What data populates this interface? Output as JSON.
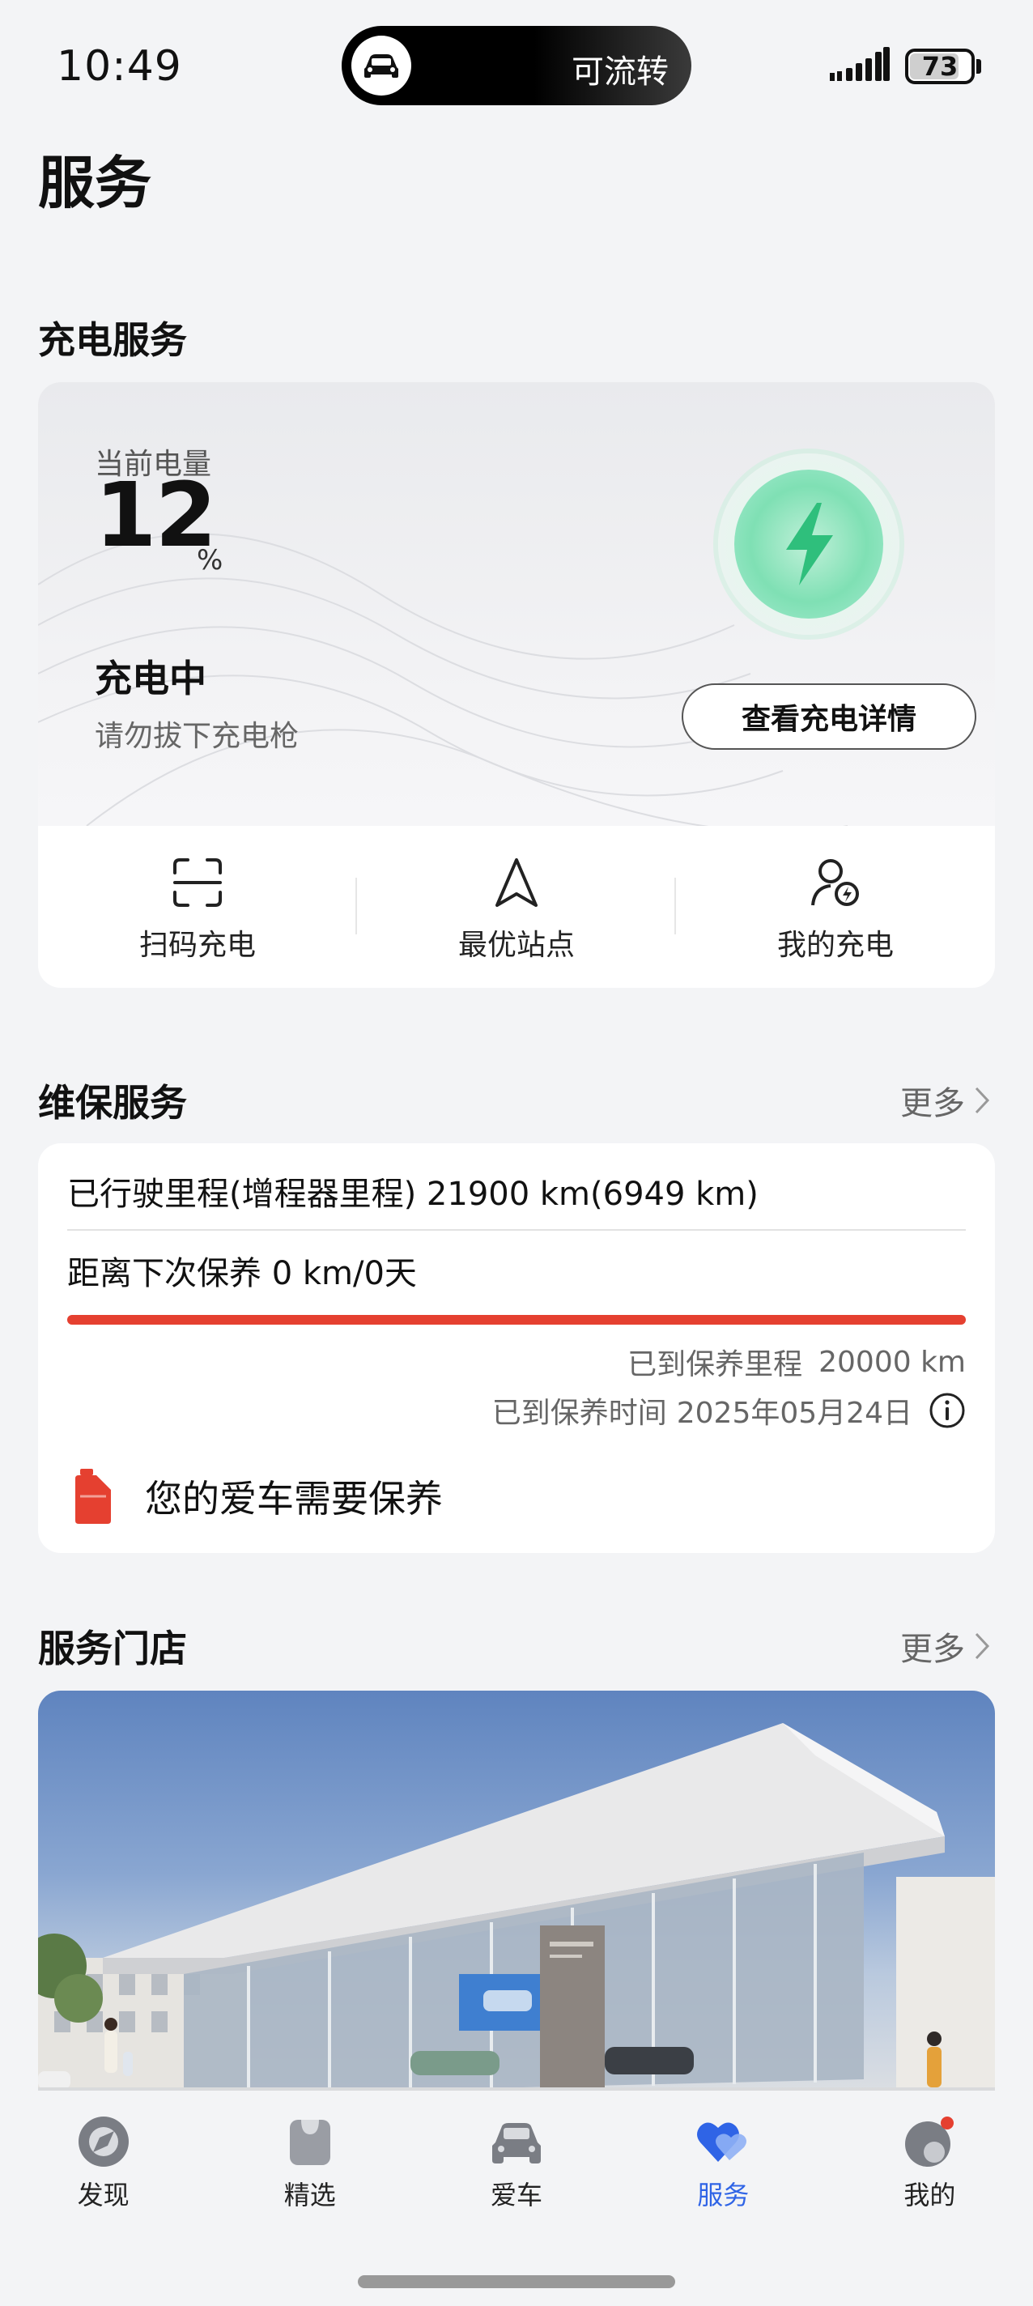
{
  "status_bar": {
    "time": "10:49",
    "island_text": "可流转",
    "battery": "73"
  },
  "page_title": "服务",
  "charging": {
    "section_title": "充电服务",
    "current_label": "当前电量",
    "percent": "12",
    "percent_unit": "%",
    "state": "充电中",
    "hint": "请勿拔下充电枪",
    "detail_button": "查看充电详情",
    "actions": [
      {
        "label": "扫码充电",
        "icon": "scan-icon"
      },
      {
        "label": "最优站点",
        "icon": "navigation-arrow-icon"
      },
      {
        "label": "我的充电",
        "icon": "user-charge-icon"
      }
    ]
  },
  "maintenance": {
    "section_title": "维保服务",
    "more": "更多",
    "mileage": "已行驶里程(增程器里程) 21900 km(6949 km)",
    "next": "距离下次保养 0 km/0天",
    "progress": 1.0,
    "due_mileage_label": "已到保养里程",
    "due_mileage_value": "20000 km",
    "due_time_label": "已到保养时间",
    "due_time_value": "2025年05月24日",
    "alert": "您的爱车需要保养",
    "accent": "#e54030"
  },
  "stores": {
    "section_title": "服务门店",
    "more": "更多"
  },
  "tabs": [
    {
      "label": "发现",
      "icon": "discover-icon",
      "active": false
    },
    {
      "label": "精选",
      "icon": "shopping-bag-icon",
      "active": false
    },
    {
      "label": "爱车",
      "icon": "car-icon",
      "active": false
    },
    {
      "label": "服务",
      "icon": "heart-service-icon",
      "active": true
    },
    {
      "label": "我的",
      "icon": "profile-icon",
      "active": false
    }
  ],
  "colors": {
    "active_tab": "#2f64e6",
    "charge_green": "#3ccf8e"
  }
}
